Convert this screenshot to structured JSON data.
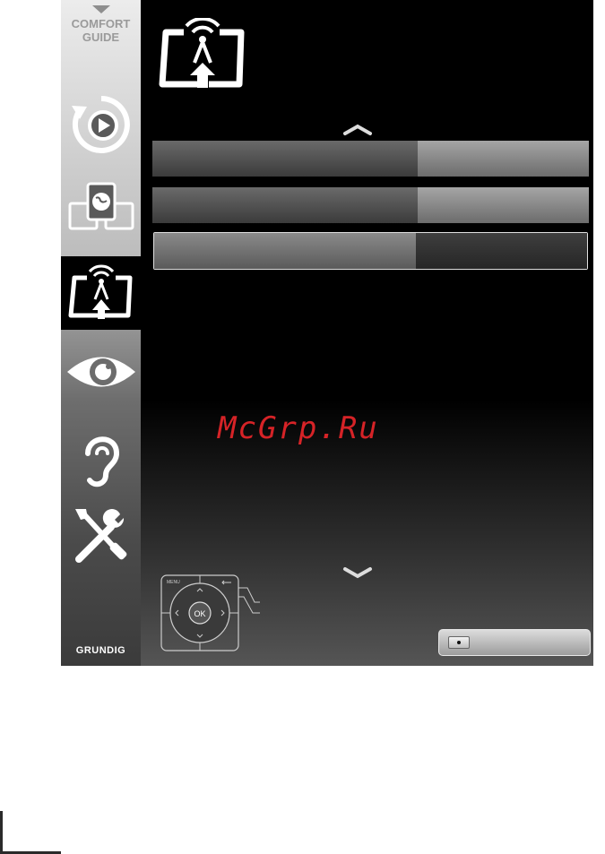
{
  "sidebar": {
    "comfort_guide": "COMFORT\nGUIDE",
    "items": [
      {
        "icon": "playback-icon"
      },
      {
        "icon": "media-network-icon"
      },
      {
        "icon": "source-antenna-icon",
        "active": true
      },
      {
        "icon": "picture-eye-icon"
      },
      {
        "icon": "sound-ear-icon"
      },
      {
        "icon": "settings-tools-icon"
      }
    ],
    "brand": "GRUNDIG"
  },
  "main": {
    "header_icon": "source-antenna-icon",
    "rows": [
      {
        "label": "",
        "value": ""
      },
      {
        "label": "",
        "value": ""
      },
      {
        "label": "",
        "value": ""
      }
    ],
    "watermark": "McGrp.Ru"
  },
  "remote_help": {
    "menu_label": "MENU",
    "ok_label": "OK"
  },
  "colors": {
    "watermark": "#e8262a",
    "background": "#000000"
  }
}
